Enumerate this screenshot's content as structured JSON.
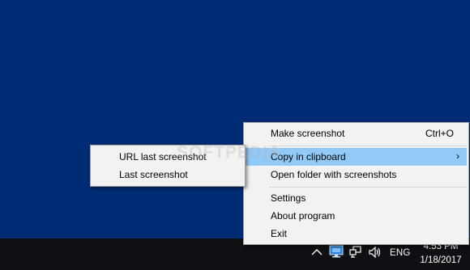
{
  "main_menu": {
    "items": [
      {
        "label": "Make screenshot",
        "shortcut": "Ctrl+O"
      },
      {
        "label": "Copy in clipboard",
        "arrow": "›"
      },
      {
        "label": "Open folder with screenshots"
      },
      {
        "label": "Settings"
      },
      {
        "label": "About program"
      },
      {
        "label": "Exit"
      }
    ]
  },
  "sub_menu": {
    "items": [
      {
        "label": "URL last screenshot"
      },
      {
        "label": "Last screenshot"
      }
    ]
  },
  "watermark": "SOFTPEDIA",
  "taskbar": {
    "language": "ENG",
    "time": "4:53 PM",
    "date": "1/18/2017",
    "icons": [
      "chevron-up-icon",
      "screenshot-app-icon",
      "network-icon",
      "volume-icon"
    ]
  },
  "colors": {
    "desktop": "#002C75",
    "taskbar": "#0E1014",
    "menu_bg": "#F2F2F2",
    "highlight": "#91C9F7"
  }
}
